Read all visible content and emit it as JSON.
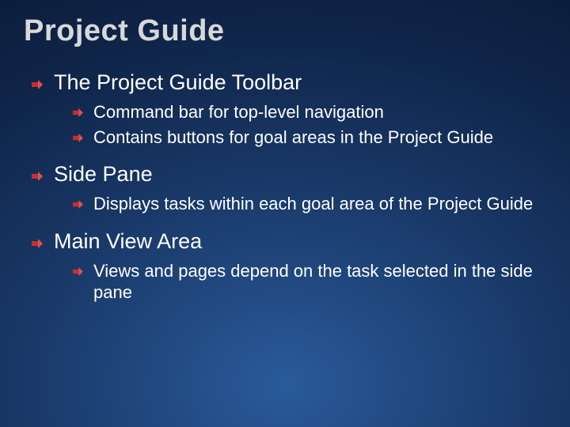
{
  "title": "Project Guide",
  "items": [
    {
      "label": "The Project Guide Toolbar",
      "children": [
        {
          "label": "Command bar for top-level navigation"
        },
        {
          "label": "Contains buttons for goal areas in the Project Guide"
        }
      ]
    },
    {
      "label": "Side Pane",
      "children": [
        {
          "label": "Displays tasks within each goal area of the Project Guide"
        }
      ]
    },
    {
      "label": "Main View Area",
      "children": [
        {
          "label": "Views and pages depend on the task selected in the side pane"
        }
      ]
    }
  ]
}
